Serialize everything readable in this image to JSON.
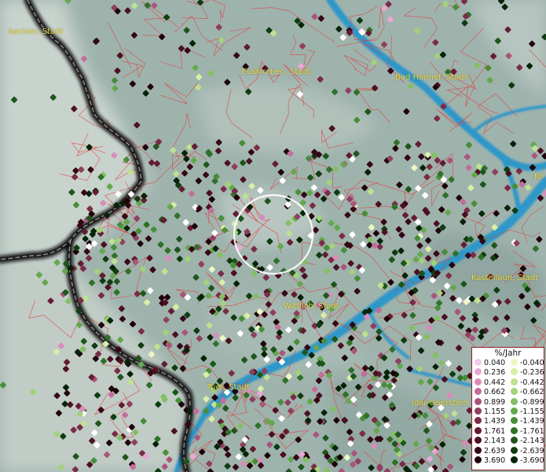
{
  "map": {
    "cities": [
      {
        "id": "aachen",
        "label": "Aachen, Stadt"
      },
      {
        "id": "euskirchen",
        "label": "Euskirchen, Stadt"
      },
      {
        "id": "bad-honnef",
        "label": "Bad Honnef, Stadt"
      },
      {
        "id": "ko",
        "label": "Ko"
      },
      {
        "id": "kastellaun",
        "label": "Kastellaun, Stadt"
      },
      {
        "id": "wittlich",
        "label": "Wittlich, Stadt"
      },
      {
        "id": "trier",
        "label": "Trier, Stadt"
      },
      {
        "id": "idar-oberstein",
        "label": "Idar-Oberstein"
      }
    ],
    "colors": {
      "terrain": "#9fb3ad",
      "relief_light": "#c9d3cd",
      "relief_dark": "#7f958f",
      "river": "#2f97c9",
      "district_border": "#e23a3a",
      "state_border": "#111111",
      "city_label": "#e7d83a"
    }
  },
  "legend": {
    "title": "%/Jahr",
    "positive": [
      {
        "label": "0.040",
        "color": "#f5c9ea"
      },
      {
        "label": "0.236",
        "color": "#eaa7d5"
      },
      {
        "label": "0.442",
        "color": "#d98cbb"
      },
      {
        "label": "0.662",
        "color": "#c46d9b"
      },
      {
        "label": "0.899",
        "color": "#a9557c"
      },
      {
        "label": "1.155",
        "color": "#8f3f5f"
      },
      {
        "label": "1.439",
        "color": "#7a2c47"
      },
      {
        "label": "1.761",
        "color": "#631d33"
      },
      {
        "label": "2.143",
        "color": "#4c1022"
      },
      {
        "label": "2.639",
        "color": "#350716"
      },
      {
        "label": "3.690",
        "color": "#1e020a"
      }
    ],
    "negative": [
      {
        "label": "-0.040",
        "color": "#eef7c4"
      },
      {
        "label": "-0.236",
        "color": "#d8efa6"
      },
      {
        "label": "-0.442",
        "color": "#bfe290"
      },
      {
        "label": "-0.662",
        "color": "#a2d27a"
      },
      {
        "label": "-0.899",
        "color": "#84bf64"
      },
      {
        "label": "-1.155",
        "color": "#64a84e"
      },
      {
        "label": "-1.439",
        "color": "#488e3a"
      },
      {
        "label": "-1.761",
        "color": "#2f7129"
      },
      {
        "label": "-2.143",
        "color": "#1d561b"
      },
      {
        "label": "-2.639",
        "color": "#0f3c10"
      },
      {
        "label": "-3.690",
        "color": "#052407"
      }
    ]
  }
}
